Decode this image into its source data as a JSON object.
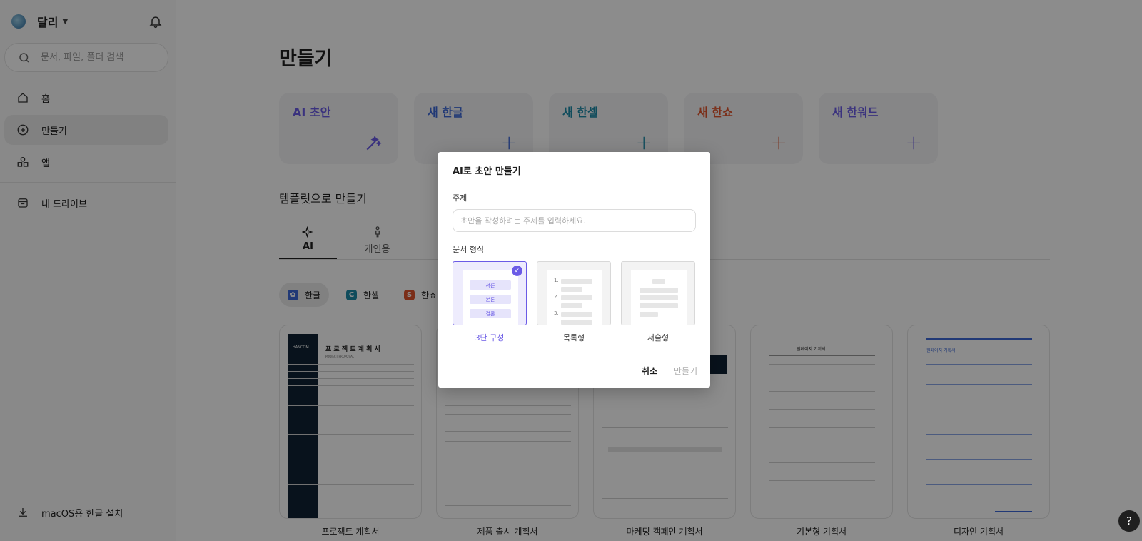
{
  "sidebar": {
    "workspace_name": "달리",
    "search_placeholder": "문서, 파일, 폴더 검색",
    "nav": {
      "home": "홈",
      "create": "만들기",
      "apps": "앱",
      "drive": "내 드라이브"
    },
    "install": "macOS용 한글 설치"
  },
  "main": {
    "title": "만들기",
    "create_cards": [
      {
        "label": "AI 초안",
        "color": "#6b5be6"
      },
      {
        "label": "새 한글",
        "color": "#3d68d8"
      },
      {
        "label": "새 한셀",
        "color": "#1d8aa8"
      },
      {
        "label": "새 한쇼",
        "color": "#e0552d"
      },
      {
        "label": "새 한워드",
        "color": "#6b5be6"
      }
    ],
    "template_section_title": "템플릿으로 만들기",
    "tabs": [
      "AI",
      "개인용"
    ],
    "chips": [
      "한글",
      "한셀",
      "한쇼"
    ],
    "templates": [
      "프로젝트 계획서",
      "제품 출시 계획서",
      "마케팅 캠페인 계획서",
      "기본형 기획서",
      "디자인 기획서"
    ],
    "preview_text": {
      "project_logo": "HANCOM",
      "project_title": "프 로 젝 트 계 획 서",
      "project_subtitle": "PROJECT PROPOSAL",
      "basic_title": "원페이지 기획서",
      "design_title": "원페이지 기획서"
    }
  },
  "dialog": {
    "title": "AI로 초안 만들기",
    "topic_label": "주제",
    "topic_placeholder": "초안을 작성하려는 주제를 입력하세요.",
    "format_label": "문서 형식",
    "formats": [
      "3단 구성",
      "목록형",
      "서술형"
    ],
    "three_part_tags": [
      "서론",
      "본론",
      "결론"
    ],
    "list_numbers": [
      "1.",
      "2.",
      "3."
    ],
    "cancel_label": "취소",
    "create_label": "만들기"
  },
  "help_label": "?",
  "colors": {
    "accent": "#6b5be6",
    "hangul": "#3d68d8",
    "hancell": "#1d8aa8",
    "hanshow": "#e0552d"
  }
}
